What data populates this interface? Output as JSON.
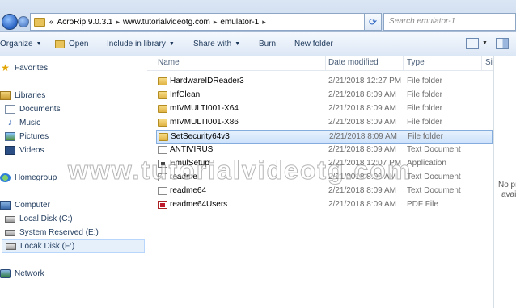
{
  "address": {
    "back_icon": "back-arrow-icon",
    "forward_icon": "forward-arrow-icon",
    "leading": "«",
    "segments": [
      "AcroRip 9.0.3.1",
      "www.tutorialvideotg.com",
      "emulator-1"
    ],
    "separator": "▸",
    "refresh_icon": "refresh-icon"
  },
  "search": {
    "placeholder": "Search emulator-1"
  },
  "toolbar": {
    "organize": "Organize",
    "open": "Open",
    "include_in_library": "Include in library",
    "share_with": "Share with",
    "burn": "Burn",
    "new_folder": "New folder"
  },
  "sidebar": {
    "favorites": "Favorites",
    "libraries": "Libraries",
    "documents": "Documents",
    "music": "Music",
    "pictures": "Pictures",
    "videos": "Videos",
    "homegroup": "Homegroup",
    "computer": "Computer",
    "local_c": "Local Disk (C:)",
    "system_e": "System Reserved (E:)",
    "local_f": "Locak Disk (F:)",
    "network": "Network"
  },
  "columns": {
    "name": "Name",
    "date": "Date modified",
    "type": "Type",
    "size": "Si"
  },
  "files": [
    {
      "name": "HardwareIDReader3",
      "date": "2/21/2018 12:27 PM",
      "type": "File folder",
      "icon": "folder-icon"
    },
    {
      "name": "InfClean",
      "date": "2/21/2018 8:09 AM",
      "type": "File folder",
      "icon": "folder-icon"
    },
    {
      "name": "mIVMULTI001-X64",
      "date": "2/21/2018 8:09 AM",
      "type": "File folder",
      "icon": "folder-icon"
    },
    {
      "name": "mIVMULTI001-X86",
      "date": "2/21/2018 8:09 AM",
      "type": "File folder",
      "icon": "folder-icon"
    },
    {
      "name": "SetSecurity64v3",
      "date": "2/21/2018 8:09 AM",
      "type": "File folder",
      "icon": "folder-icon"
    },
    {
      "name": "ANTIVIRUS",
      "date": "2/21/2018 8:09 AM",
      "type": "Text Document",
      "icon": "text-file-icon"
    },
    {
      "name": "EmulSetup",
      "date": "2/21/2018 12:07 PM",
      "type": "Application",
      "icon": "app-icon"
    },
    {
      "name": "readme",
      "date": "2/21/2018 8:09 AM",
      "type": "Text Document",
      "icon": "text-file-icon"
    },
    {
      "name": "readme64",
      "date": "2/21/2018 8:09 AM",
      "type": "Text Document",
      "icon": "text-file-icon"
    },
    {
      "name": "readme64Users",
      "date": "2/21/2018 8:09 AM",
      "type": "PDF File",
      "icon": "pdf-icon"
    }
  ],
  "preview": {
    "line1": "No pr",
    "line2": "avai"
  },
  "watermark": "www.tutorialvideotg.com"
}
